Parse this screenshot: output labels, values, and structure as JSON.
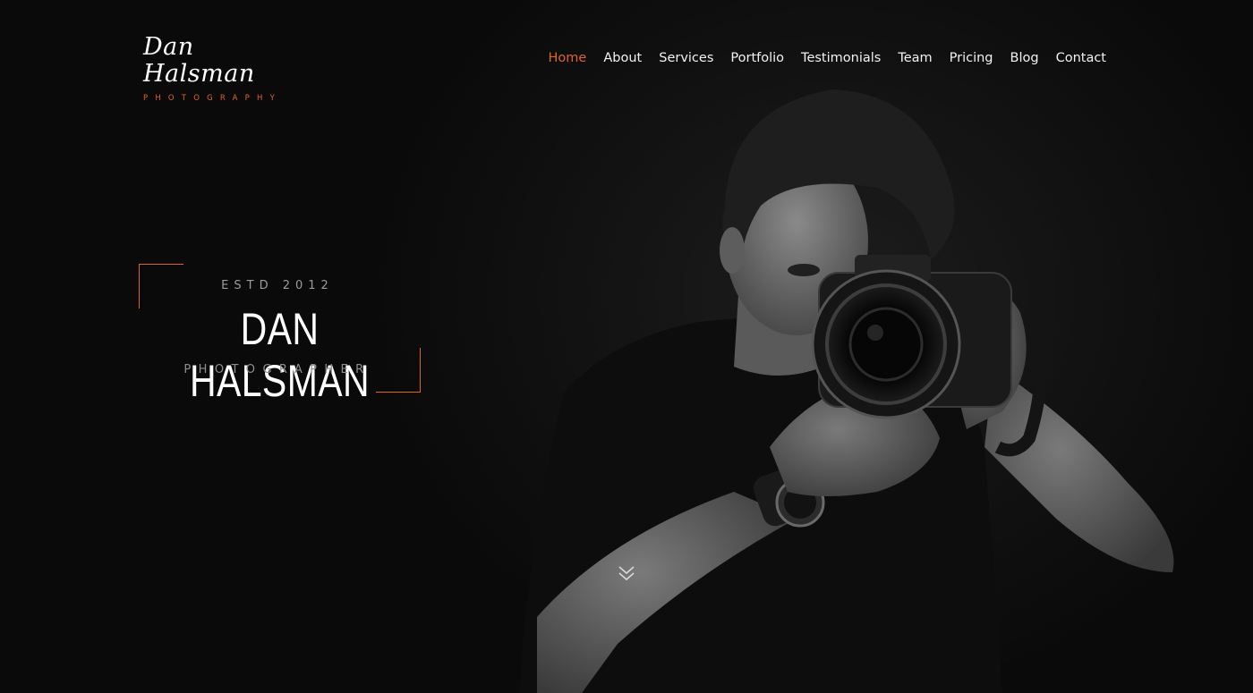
{
  "brand": {
    "name": "Dan Halsman",
    "tagline": "PHOTOGRAPHY",
    "accent_color": "#e0632b"
  },
  "nav": {
    "items": [
      {
        "label": "Home",
        "active": true
      },
      {
        "label": "About",
        "active": false
      },
      {
        "label": "Services",
        "active": false
      },
      {
        "label": "Portfolio",
        "active": false
      },
      {
        "label": "Testimonials",
        "active": false
      },
      {
        "label": "Team",
        "active": false
      },
      {
        "label": "Pricing",
        "active": false
      },
      {
        "label": "Blog",
        "active": false
      },
      {
        "label": "Contact",
        "active": false
      }
    ]
  },
  "hero": {
    "established": "ESTD 2012",
    "name": "DAN HALSMAN",
    "role": "PHOTOGRAPHER"
  },
  "icons": {
    "scroll": "double-chevron-down-icon"
  }
}
